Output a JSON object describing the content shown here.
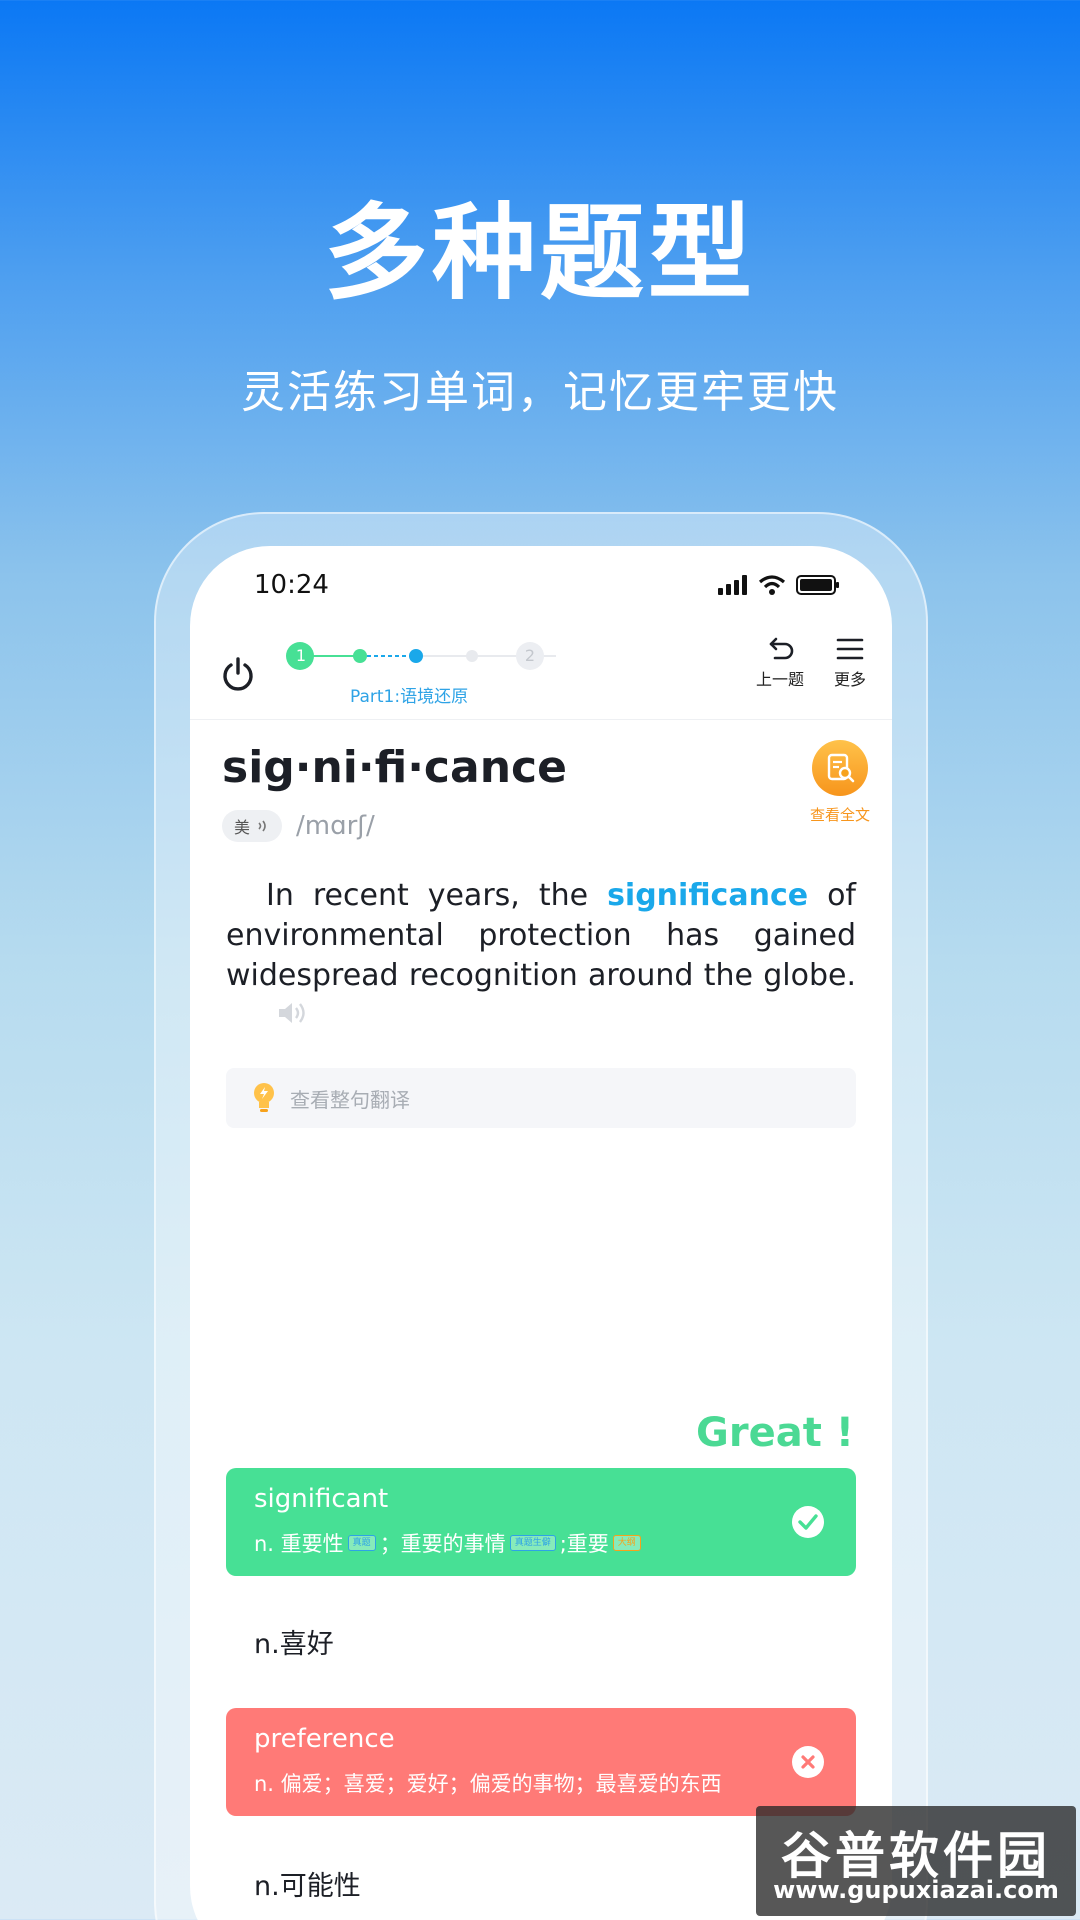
{
  "hero": {
    "title": "多种题型",
    "subtitle": "灵活练习单词，记忆更牢更快"
  },
  "statusbar": {
    "time": "10:24"
  },
  "topbar": {
    "step1": "1",
    "step2": "2",
    "part_label": "Part1:语境还原",
    "prev_label": "上一题",
    "more_label": "更多"
  },
  "word": {
    "text": "sig·ni·fi·cance",
    "accent": "美",
    "phonetic": "/mɑrʃ/",
    "lookup_label": "查看全文"
  },
  "sentence": {
    "before": "In recent years, the ",
    "highlight": "significance",
    "after": " of environmental protection has gained widespread recognition around the globe."
  },
  "translate": {
    "label": "查看整句翻译"
  },
  "feedback": {
    "great": "Great !"
  },
  "options": {
    "correct": {
      "title": "significant",
      "part1": "n. 重要性",
      "tag1": "真题",
      "part2": "；重要的事情",
      "tag2": "真题生僻",
      "part3": ";重要",
      "tag3": "大纲"
    },
    "plain1": "n.喜好",
    "wrong": {
      "title": "preference",
      "sub": "n. 偏爱；喜爱；爱好；偏爱的事物；最喜爱的东西"
    },
    "plain2": "n.可能性"
  },
  "watermark": {
    "cn": "谷普软件园",
    "en": "www.gupuxiazai.com"
  },
  "colors": {
    "correct": "#47e095",
    "wrong": "#ff7a77",
    "accent_blue": "#1aa8ea",
    "orange": "#f7951c"
  }
}
